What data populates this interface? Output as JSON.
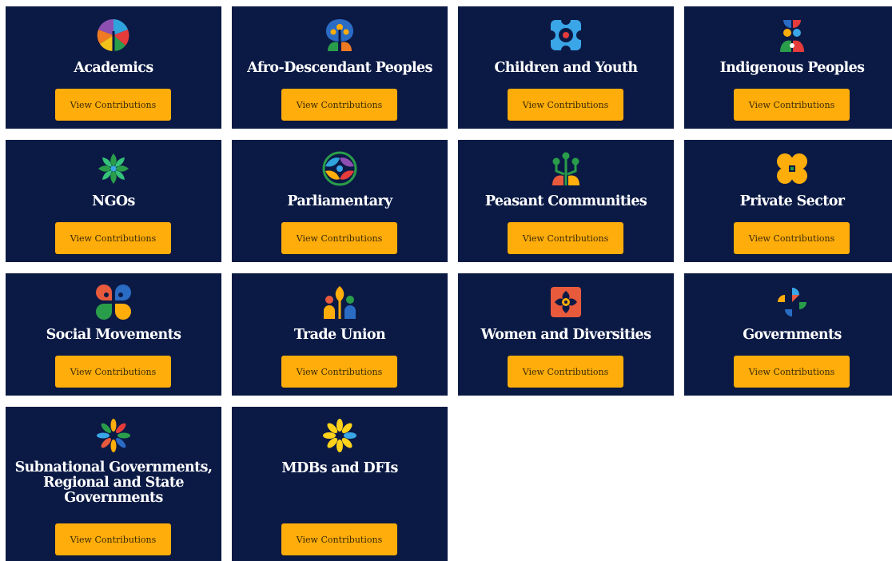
{
  "accent": "#ffad0a",
  "card_bg": "#0b1a45",
  "cards": [
    {
      "title": "Academics",
      "button_label": "View Contributions",
      "icon": "leaf-circle-icon"
    },
    {
      "title": "Afro-Descendant Peoples",
      "button_label": "View Contributions",
      "icon": "tree-blossom-icon"
    },
    {
      "title": "Children and Youth",
      "button_label": "View Contributions",
      "icon": "quatrefoil-flower-icon"
    },
    {
      "title": "Indigenous Peoples",
      "button_label": "View Contributions",
      "icon": "totem-petals-icon"
    },
    {
      "title": "NGOs",
      "button_label": "View Contributions",
      "icon": "star-leaves-icon"
    },
    {
      "title": "Parliamentary",
      "button_label": "View Contributions",
      "icon": "globe-leaves-icon"
    },
    {
      "title": "Peasant Communities",
      "button_label": "View Contributions",
      "icon": "sprout-icon"
    },
    {
      "title": "Private Sector",
      "button_label": "View Contributions",
      "icon": "four-petal-flower-icon"
    },
    {
      "title": "Social Movements",
      "button_label": "View Contributions",
      "icon": "four-petal-drops-icon"
    },
    {
      "title": "Trade Union",
      "button_label": "View Contributions",
      "icon": "people-leaf-icon"
    },
    {
      "title": "Women and Diversities",
      "button_label": "View Contributions",
      "icon": "orange-flower-frame-icon"
    },
    {
      "title": "Governments",
      "button_label": "View Contributions",
      "icon": "pinwheel-icon"
    },
    {
      "title": "Subnational Governments, Regional and State Governments",
      "button_label": "View Contributions",
      "icon": "sunburst-petals-icon"
    },
    {
      "title": "MDBs and DFIs",
      "button_label": "View Contributions",
      "icon": "daisy-icon"
    }
  ]
}
